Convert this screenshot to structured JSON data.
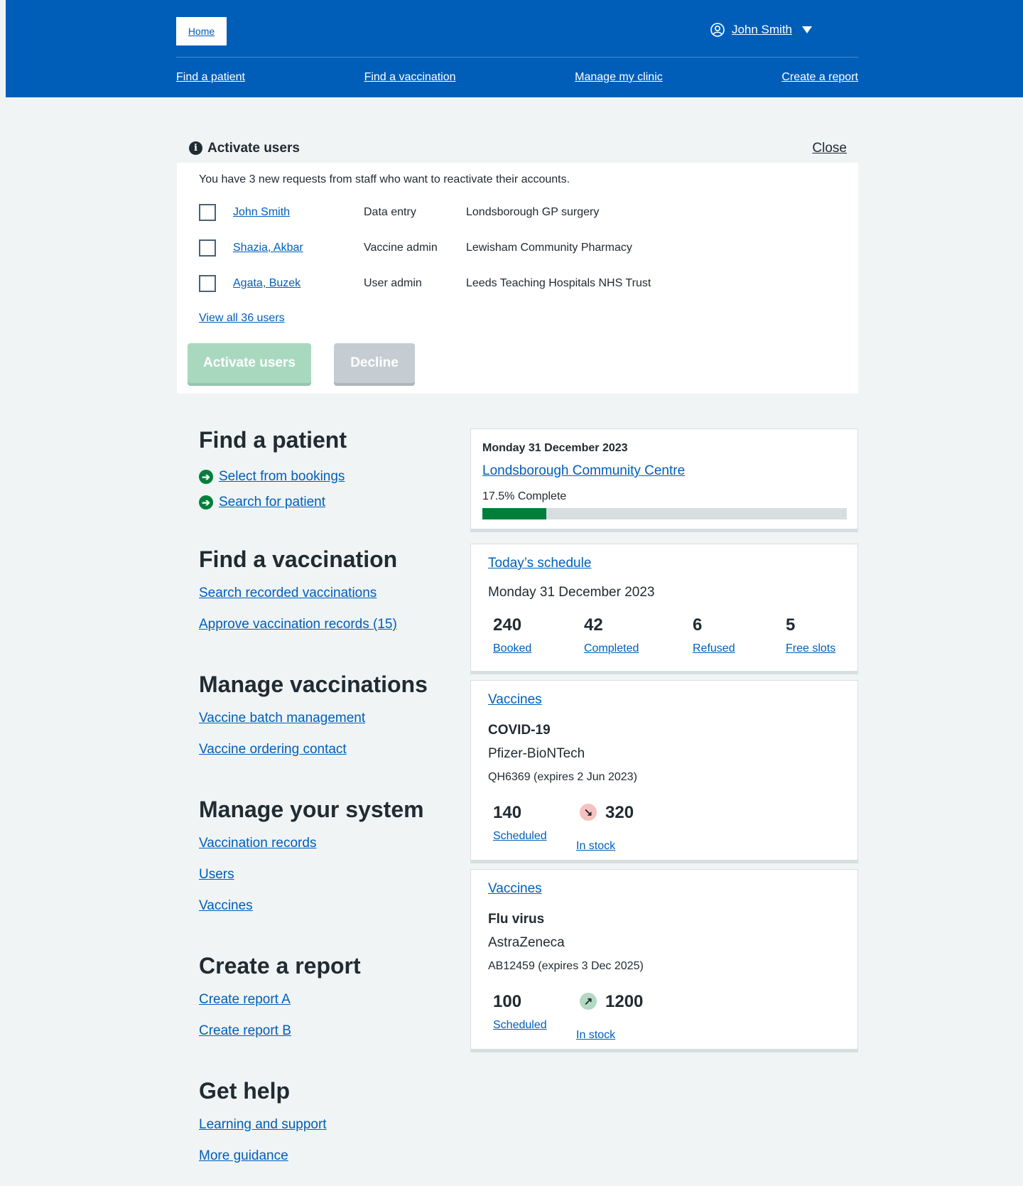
{
  "header": {
    "home_label": "Home",
    "user_name": "John Smith",
    "nav": [
      "Find a patient",
      "Find a vaccination",
      "Manage my clinic",
      "Create a report"
    ]
  },
  "activate_panel": {
    "title": "Activate users",
    "close_label": "Close",
    "intro": "You have 3 new requests from staff who want to reactivate their accounts.",
    "users": [
      {
        "name": "John Smith",
        "role": "Data entry",
        "org": "Londsborough GP surgery"
      },
      {
        "name": "Shazia, Akbar",
        "role": "Vaccine admin",
        "org": "Lewisham Community Pharmacy"
      },
      {
        "name": "Agata, Buzek",
        "role": "User admin",
        "org": "Leeds Teaching Hospitals NHS Trust"
      }
    ],
    "view_all_label": "View all 36 users",
    "activate_label": "Activate users",
    "decline_label": "Decline"
  },
  "sections": {
    "find_patient": {
      "title": "Find a patient",
      "links": [
        "Select from bookings",
        "Search for patient"
      ]
    },
    "find_vaccination": {
      "title": "Find a vaccination",
      "links": [
        "Search recorded vaccinations",
        "Approve vaccination records (15)"
      ]
    },
    "manage_vaccinations": {
      "title": "Manage vaccinations",
      "links": [
        "Vaccine batch management",
        "Vaccine ordering contact"
      ]
    },
    "manage_system": {
      "title": "Manage your system",
      "links": [
        "Vaccination records",
        "Users",
        "Vaccines"
      ]
    },
    "create_report": {
      "title": "Create a report",
      "links": [
        "Create report A",
        "Create report B"
      ]
    },
    "get_help": {
      "title": "Get help",
      "links": [
        "Learning and support",
        "More guidance"
      ]
    }
  },
  "progress_card": {
    "date": "Monday 31 December 2023",
    "site": "Londsborough Community Centre",
    "percent_label": "17.5% Complete",
    "percent": 17.5,
    "fill_color": "#007f3b"
  },
  "schedule_card": {
    "title": "Today’s schedule",
    "date": "Monday 31 December 2023",
    "stats": [
      {
        "value": "240",
        "label": "Booked"
      },
      {
        "value": "42",
        "label": "Completed"
      },
      {
        "value": "6",
        "label": "Refused"
      },
      {
        "value": "5",
        "label": "Free slots"
      }
    ]
  },
  "vaccine_cards": [
    {
      "title": "Vaccines",
      "name": "COVID-19",
      "brand": "Pfizer-BioNTech",
      "batch": "QH6369 (expires 2 Jun 2023)",
      "scheduled_value": "140",
      "scheduled_label": "Scheduled",
      "stock_value": "320",
      "stock_label": "In stock",
      "trend_icon": "arrow-down-right-icon",
      "trend": "down"
    },
    {
      "title": "Vaccines",
      "name": "Flu virus",
      "brand": "AstraZeneca",
      "batch": "AB12459 (expires 3 Dec 2025)",
      "scheduled_value": "100",
      "scheduled_label": "Scheduled",
      "stock_value": "1200",
      "stock_label": "In stock",
      "trend_icon": "arrow-up-right-icon",
      "trend": "up"
    }
  ],
  "colors": {
    "brand_blue": "#005eb8",
    "success_green": "#007f3b",
    "page_bg": "#f0f4f5"
  }
}
